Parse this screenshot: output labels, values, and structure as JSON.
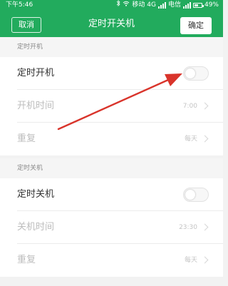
{
  "status_bar": {
    "time": "下午5:46",
    "carrier1": "移动 4G",
    "carrier2": "电信",
    "battery": "49%"
  },
  "nav": {
    "cancel_label": "取消",
    "title": "定时开关机",
    "confirm_label": "确定"
  },
  "power_on": {
    "section_title": "定时开机",
    "toggle_label": "定时开机",
    "enabled": false,
    "time_label": "开机时间",
    "time_value": "7:00",
    "repeat_label": "重复",
    "repeat_value": "每天"
  },
  "power_off": {
    "section_title": "定时关机",
    "toggle_label": "定时关机",
    "enabled": false,
    "time_label": "关机时间",
    "time_value": "23:30",
    "repeat_label": "重复",
    "repeat_value": "每天"
  },
  "colors": {
    "accent": "#22ab5d",
    "arrow": "#d9342b"
  }
}
